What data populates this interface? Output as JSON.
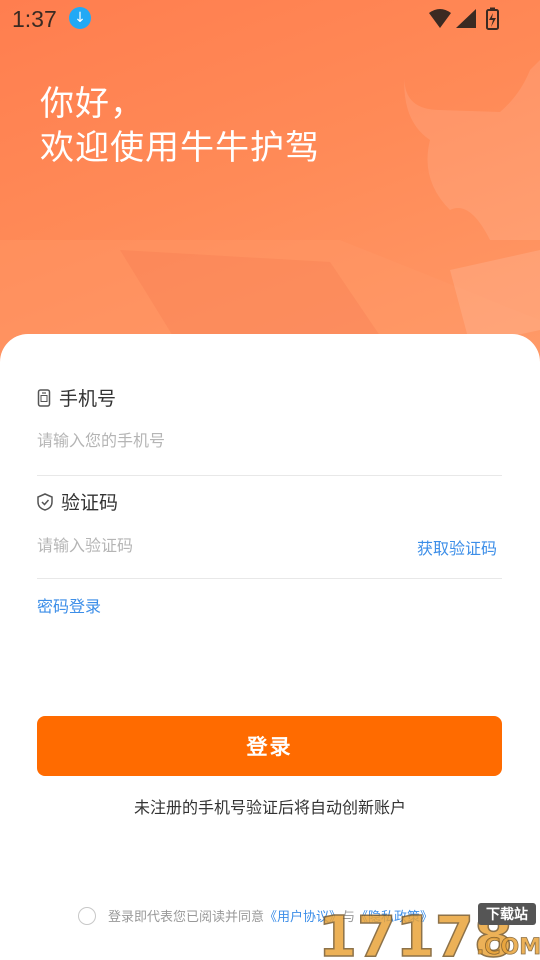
{
  "status_bar": {
    "time": "1:37",
    "icons": [
      "download-icon",
      "wifi-icon",
      "signal-icon",
      "battery-charging-icon"
    ]
  },
  "header": {
    "greeting_line1": "你好，",
    "greeting_line2": "欢迎使用牛牛护驾"
  },
  "phone": {
    "label": "手机号",
    "placeholder": "请输入您的手机号",
    "icon": "phone-icon"
  },
  "code": {
    "label": "验证码",
    "placeholder": "请输入验证码",
    "get_code_label": "获取验证码",
    "icon": "shield-icon"
  },
  "password_login_label": "密码登录",
  "login_button_label": "登录",
  "hint_text": "未注册的手机号验证后将自动创新账户",
  "agreement": {
    "prefix": "登录即代表您已阅读并同意",
    "user_agreement": "《用户协议》",
    "joiner": "与",
    "privacy_policy": "《隐私政策》"
  },
  "watermark": {
    "text": "17178",
    "badge": "下载站",
    "suffix": ".COM"
  },
  "colors": {
    "hero": "#ff8a57",
    "accent": "#ff6b00",
    "link": "#3c8ee8"
  }
}
